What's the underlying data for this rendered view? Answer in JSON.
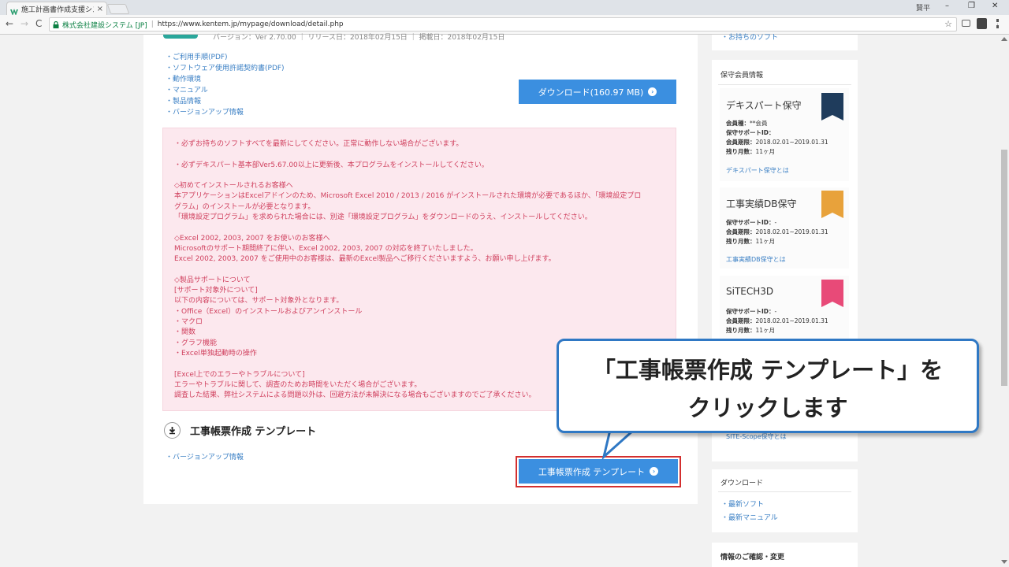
{
  "browser": {
    "tab_title": "施工計画書作成支援シス",
    "tab_close": "×",
    "user_chip": "賢平",
    "min": "–",
    "max": "❐",
    "close": "✕",
    "back": "←",
    "forward": "→",
    "reload": "C",
    "secure_label": "株式会社建設システム [JP]",
    "separator": "|",
    "url": "https://www.kentem.jp/mypage/download/detail.php",
    "star": "☆"
  },
  "product": {
    "cut_text": "バージョン：Ver 2.70.00  ｜ リリース日：2018年02月15日  ｜ 掲載日：2018年02月15日",
    "links": [
      "・ご利用手順(PDF)",
      "・ソフトウェア使用許諾契約書(PDF)",
      "・動作環境",
      "・マニュアル",
      "・製品情報",
      "・バージョンアップ情報"
    ],
    "download_label": "ダウンロード(160.97 MB)",
    "download_icon": "›"
  },
  "notice": {
    "lines": [
      "・必ずお持ちのソフトすべてを最新にしてください。正常に動作しない場合がございます。",
      "",
      "・必ずデキスパート基本部Ver5.67.00以上に更新後、本プログラムをインストールしてください。",
      "",
      "◇初めてインストールされるお客様へ",
      "本アプリケーションはExcelアドインのため、Microsoft Excel 2010 / 2013 / 2016 がインストールされた環境が必要であるほか、「環境設定プロ",
      "グラム」のインストールが必要となります。",
      "「環境設定プログラム」を求められた場合には、別途「環境設定プログラム」をダウンロードのうえ、インストールしてください。",
      "",
      "◇Excel 2002, 2003, 2007 をお使いのお客様へ",
      "Microsoftのサポート期間終了に伴い、Excel 2002, 2003, 2007 の対応を終了いたしました。",
      "Excel 2002, 2003, 2007 をご使用中のお客様は、最新のExcel製品へご移行くださいますよう、お願い申し上げます。",
      "",
      "◇製品サポートについて",
      "[サポート対象外について]",
      "以下の内容については、サポート対象外となります。",
      "・Office（Excel）のインストールおよびアンインストール",
      "・マクロ",
      "・関数",
      "・グラフ機能",
      "・Excel単独起動時の操作",
      "",
      "[Excel上でのエラーやトラブルについて]",
      "エラーやトラブルに関して、調査のためお時間をいただく場合がございます。",
      "調査した結果、弊社システムによる問題以外は、回避方法が未解決になる場合もございますのでご了承ください。"
    ]
  },
  "section": {
    "title": "工事帳票作成 テンプレート",
    "version_link": "・バージョンアップ情報",
    "button_label": "工事帳票作成 テンプレート",
    "button_icon": "›"
  },
  "sidebar": {
    "top_link": "・お持ちのソフト",
    "member_header": "保守会員情報",
    "plans": [
      {
        "name": "デキスパート保守",
        "color": "#1f3c5c",
        "info": [
          {
            "k": "会員種：",
            "v": "**会員"
          },
          {
            "k": "保守サポートID：",
            "v": ""
          },
          {
            "k": "会員期限：",
            "v": "2018.02.01~2019.01.31"
          },
          {
            "k": "残り月数：",
            "v": "11ヶ月"
          }
        ],
        "link": "デキスパート保守とは"
      },
      {
        "name": "工事実績DB保守",
        "color": "#e8a23b",
        "info": [
          {
            "k": "保守サポートID：",
            "v": "-"
          },
          {
            "k": "会員期限：",
            "v": "2018.02.01~2019.01.31"
          },
          {
            "k": "残り月数：",
            "v": "11ヶ月"
          }
        ],
        "link": "工事実績DB保守とは"
      },
      {
        "name": "SiTECH3D",
        "color": "#e84a78",
        "info": [
          {
            "k": "保守サポートID：",
            "v": "-"
          },
          {
            "k": "会員期限：",
            "v": "2018.02.01~2019.01.31"
          },
          {
            "k": "残り月数：",
            "v": "11ヶ月"
          }
        ],
        "link": ""
      }
    ],
    "partial_link": "SITE-Scope保守とは",
    "download_header": "ダウンロード",
    "download_links": [
      "・最新ソフト",
      "・最新マニュアル"
    ],
    "info_header": "情報のご確認・変更"
  },
  "callout": {
    "line1": "「工事帳票作成 テンプレート」を",
    "line2": "クリックします"
  }
}
